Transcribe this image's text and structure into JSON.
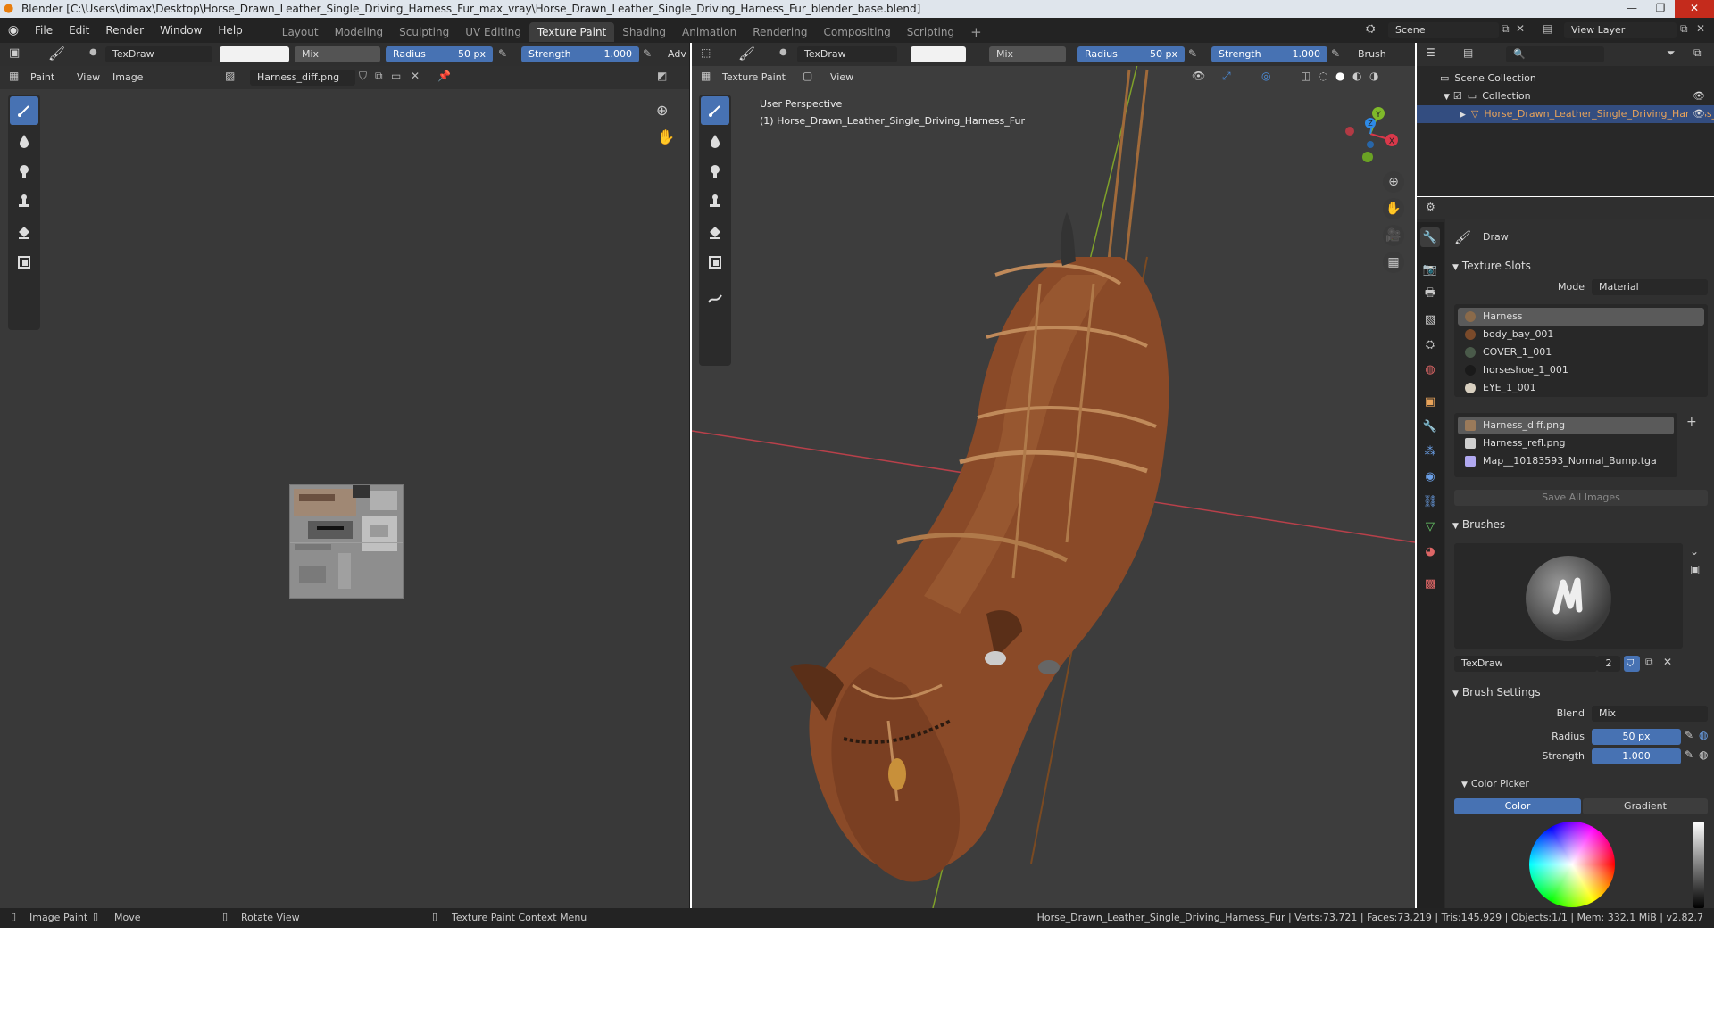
{
  "window": {
    "title": "Blender [C:\\Users\\dimax\\Desktop\\Horse_Drawn_Leather_Single_Driving_Harness_Fur_max_vray\\Horse_Drawn_Leather_Single_Driving_Harness_Fur_blender_base.blend]"
  },
  "menu": [
    "File",
    "Edit",
    "Render",
    "Window",
    "Help"
  ],
  "workspaces": [
    {
      "label": "Layout",
      "active": false
    },
    {
      "label": "Modeling",
      "active": false
    },
    {
      "label": "Sculpting",
      "active": false
    },
    {
      "label": "UV Editing",
      "active": false
    },
    {
      "label": "Texture Paint",
      "active": true
    },
    {
      "label": "Shading",
      "active": false
    },
    {
      "label": "Animation",
      "active": false
    },
    {
      "label": "Rendering",
      "active": false
    },
    {
      "label": "Compositing",
      "active": false
    },
    {
      "label": "Scripting",
      "active": false
    }
  ],
  "add_workspace": "+",
  "scene": {
    "name": "Scene",
    "view_layer": "View Layer"
  },
  "image_editor": {
    "brush_name": "TexDraw",
    "blend": "Mix",
    "radius_label": "Radius",
    "radius_value": "50 px",
    "strength_label": "Strength",
    "strength_value": "1.000",
    "adv": "Adv",
    "mode": "Paint",
    "view": "View",
    "image_menu": "Image",
    "image_name": "Harness_diff.png"
  },
  "viewport": {
    "brush_name": "TexDraw",
    "blend": "Mix",
    "radius_label": "Radius",
    "radius_value": "50 px",
    "strength_label": "Strength",
    "strength_value": "1.000",
    "brush_menu": "Brush",
    "mode": "Texture Paint",
    "view": "View",
    "perspective": "User Perspective",
    "object_info": "(1) Horse_Drawn_Leather_Single_Driving_Harness_Fur",
    "axes": {
      "x": "X",
      "y": "Y",
      "z": "Z"
    }
  },
  "outliner": {
    "scene_collection": "Scene Collection",
    "collection": "Collection",
    "object": "Horse_Drawn_Leather_Single_Driving_Harness_Fur"
  },
  "properties": {
    "tool_name": "Draw",
    "texture_slots_title": "Texture Slots",
    "mode_label": "Mode",
    "mode_value": "Material",
    "materials": [
      {
        "name": "Harness",
        "color": "#8a6a4a",
        "selected": true
      },
      {
        "name": "body_bay_001",
        "color": "#7a4a2a",
        "selected": false
      },
      {
        "name": "COVER_1_001",
        "color": "#4a5a4a",
        "selected": false
      },
      {
        "name": "horseshoe_1_001",
        "color": "#1a1a1a",
        "selected": false
      },
      {
        "name": "EYE_1_001",
        "color": "#d8d0c0",
        "selected": false
      }
    ],
    "images": [
      {
        "name": "Harness_diff.png",
        "color": "#9a7a5a",
        "selected": true
      },
      {
        "name": "Harness_refl.png",
        "color": "#cfcfcf",
        "selected": false
      },
      {
        "name": "Map__10183593_Normal_Bump.tga",
        "color": "#b0a8f0",
        "selected": false
      }
    ],
    "save_all": "Save All Images",
    "brushes_title": "Brushes",
    "brush_name": "TexDraw",
    "brush_users": "2",
    "brush_settings_title": "Brush Settings",
    "blend_label": "Blend",
    "blend_value": "Mix",
    "radius_label": "Radius",
    "radius_value": "50 px",
    "strength_label": "Strength",
    "strength_value": "1.000",
    "color_picker_title": "Color Picker",
    "color_tab": "Color",
    "gradient_tab": "Gradient"
  },
  "statusbar": {
    "left": [
      {
        "icon": "mouse-left-icon",
        "label": "Image Paint"
      },
      {
        "icon": "mouse-middle-icon",
        "label": "Move"
      },
      {
        "icon": "mouse-right-icon",
        "label": "Rotate View"
      },
      {
        "icon": "mouse-right-icon",
        "label": "Texture Paint Context Menu"
      }
    ],
    "right": "Horse_Drawn_Leather_Single_Driving_Harness_Fur | Verts:73,721 | Faces:73,219 | Tris:145,929 | Objects:1/1 | Mem: 332.1 MiB | v2.82.7"
  },
  "colors": {
    "accent": "#4772b3",
    "header_bg": "#2f2f2f",
    "area_bg": "#393939",
    "viewport_bg": "#3d3d3d",
    "axis_x": "#d9384a",
    "axis_y": "#7fb92a",
    "axis_z": "#2e8ae6"
  }
}
